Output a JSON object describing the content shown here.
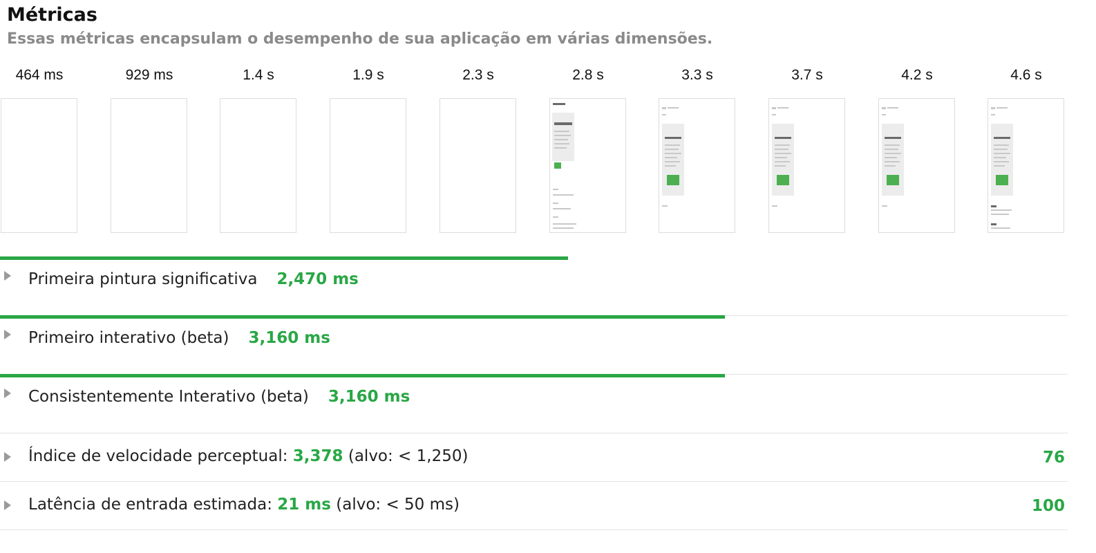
{
  "header": {
    "title": "Métricas",
    "subtitle": "Essas métricas encapsulam o desempenho de sua aplicação em várias dimensões."
  },
  "filmstrip": [
    {
      "time": "464 ms",
      "state": "blank"
    },
    {
      "time": "929 ms",
      "state": "blank"
    },
    {
      "time": "1.4 s",
      "state": "blank"
    },
    {
      "time": "1.9 s",
      "state": "blank"
    },
    {
      "time": "2.3 s",
      "state": "blank"
    },
    {
      "time": "2.8 s",
      "state": "partial"
    },
    {
      "time": "3.3 s",
      "state": "loaded"
    },
    {
      "time": "3.7 s",
      "state": "loaded"
    },
    {
      "time": "4.2 s",
      "state": "loaded"
    },
    {
      "time": "4.6 s",
      "state": "loaded-extra"
    }
  ],
  "metrics": [
    {
      "label": "Primeira pintura significativa",
      "value": "2,470 ms",
      "bar_fraction": 0.532
    },
    {
      "label": "Primeiro interativo (beta)",
      "value": "3,160 ms",
      "bar_fraction": 0.679
    },
    {
      "label": "Consistentemente Interativo (beta)",
      "value": "3,160 ms",
      "bar_fraction": 0.679
    }
  ],
  "score_metrics": [
    {
      "label": "Índice de velocidade perceptual:",
      "value": "3,378",
      "target": "(alvo: < 1,250)",
      "score": "76"
    },
    {
      "label": "Latência de entrada estimada:",
      "value": "21 ms",
      "target": "(alvo: < 50 ms)",
      "score": "100"
    }
  ],
  "colors": {
    "accent": "#29a745",
    "subtitle": "#8a8a8a",
    "divider": "#e2e2e2"
  }
}
